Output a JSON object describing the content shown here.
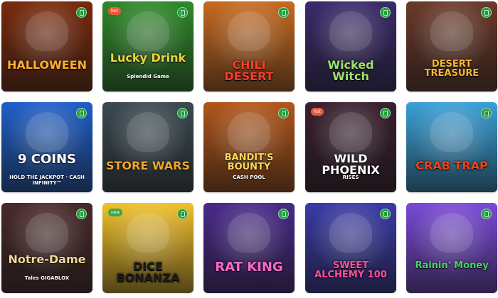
{
  "games": [
    {
      "title": "HALLOWEEN",
      "subtitle": "",
      "pill": "",
      "bg": "#7a2a0c",
      "fg": "#ffb02e",
      "badge_color": "#1f9e3a"
    },
    {
      "title": "Lucky Drink",
      "subtitle": "Splendid Game",
      "pill": "hot",
      "bg": "#2f8a2a",
      "fg": "#f4d33a",
      "badge_color": "#1f9e3a"
    },
    {
      "title": "CHILI DESERT",
      "subtitle": "",
      "pill": "",
      "bg": "#c86b1f",
      "fg": "#ff3b2b",
      "badge_color": "#1f9e3a"
    },
    {
      "title": "Wicked Witch",
      "subtitle": "",
      "pill": "",
      "bg": "#3b2a6b",
      "fg": "#9be26a",
      "badge_color": "#1f9e3a"
    },
    {
      "title": "DESERT TREASURE",
      "subtitle": "",
      "pill": "",
      "bg": "#6b3a2a",
      "fg": "#f7b733",
      "badge_color": "#1f9e3a"
    },
    {
      "title": "9 COINS",
      "subtitle": "HOLD THE JACKPOT · CASH INFINITY™",
      "pill": "",
      "bg": "#1f5fc9",
      "fg": "#ffffff",
      "badge_color": "#1f9e3a"
    },
    {
      "title": "STORE WARS",
      "subtitle": "",
      "pill": "",
      "bg": "#3b4a52",
      "fg": "#f1a62b",
      "badge_color": "#1f9e3a"
    },
    {
      "title": "BANDIT'S BOUNTY",
      "subtitle": "CASH POOL",
      "pill": "",
      "bg": "#b2561a",
      "fg": "#ffd65a",
      "badge_color": "#1f9e3a"
    },
    {
      "title": "WILD PHOENIX",
      "subtitle": "RISES",
      "pill": "hot",
      "bg": "#3a2030",
      "fg": "#ffffff",
      "badge_color": "#1f9e3a"
    },
    {
      "title": "CRAB TRAP",
      "subtitle": "",
      "pill": "",
      "bg": "#3aa0d8",
      "fg": "#e8431f",
      "badge_color": "#1f9e3a"
    },
    {
      "title": "Notre-Dame",
      "subtitle": "Tales GIGABLOX",
      "pill": "",
      "bg": "#4a2a2a",
      "fg": "#f0d79a",
      "badge_color": "#1f9e3a"
    },
    {
      "title": "DICE BONANZA",
      "subtitle": "",
      "pill": "new",
      "bg": "#f2c12a",
      "fg": "#1b1b1b",
      "badge_color": "#1f9e3a"
    },
    {
      "title": "RAT KING",
      "subtitle": "",
      "pill": "",
      "bg": "#4a2a8a",
      "fg": "#ff69c8",
      "badge_color": "#1f9e3a"
    },
    {
      "title": "SWEET ALCHEMY 100",
      "subtitle": "",
      "pill": "",
      "bg": "#3a3aa8",
      "fg": "#ff4fa0",
      "badge_color": "#1f9e3a"
    },
    {
      "title": "Rainin' Money",
      "subtitle": "",
      "pill": "",
      "bg": "#7a4ad8",
      "fg": "#46d36b",
      "badge_color": "#1f9e3a"
    }
  ],
  "colors": {
    "pill_hot": "#e8593d",
    "pill_new": "#3aa84a"
  }
}
